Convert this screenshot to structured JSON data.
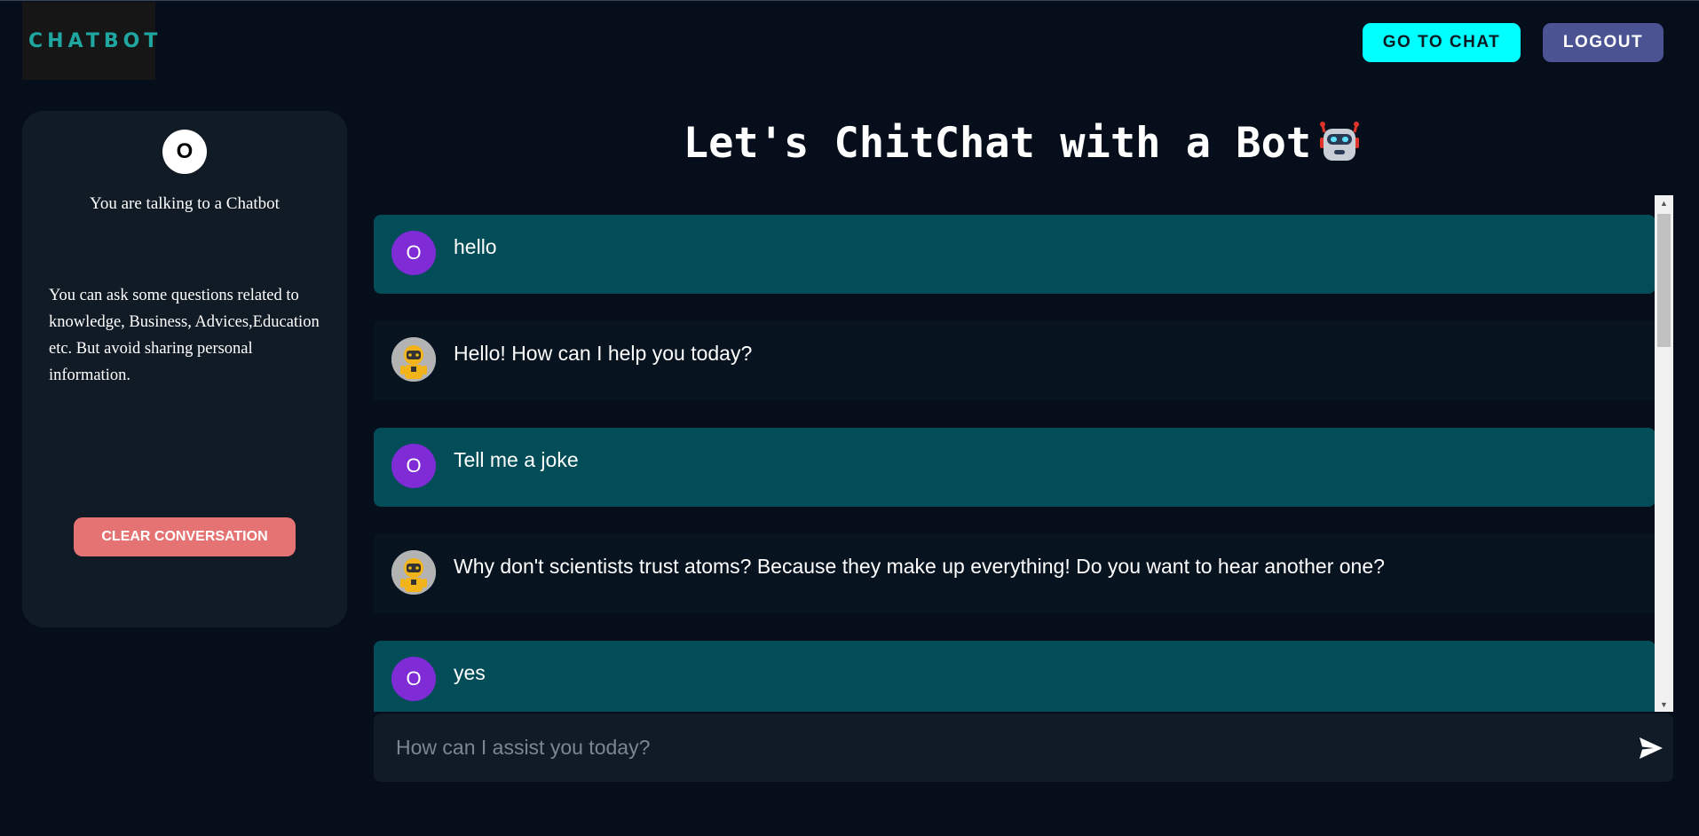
{
  "header": {
    "logo_text": "CHATBOT",
    "go_to_chat_label": "GO TO CHAT",
    "logout_label": "LOGOUT"
  },
  "sidebar": {
    "avatar_initial": "O",
    "title": "You are talking to a Chatbot",
    "description": "You can ask some questions related to knowledge, Business, Advices,Education etc. But avoid sharing personal information.",
    "clear_label": "CLEAR CONVERSATION"
  },
  "main": {
    "title": "Let's ChitChat with a Bot",
    "messages": [
      {
        "role": "user",
        "avatar": "O",
        "text": "hello"
      },
      {
        "role": "bot",
        "avatar": "robot-avatar-icon",
        "text": "Hello! How can I help you today?"
      },
      {
        "role": "user",
        "avatar": "O",
        "text": "Tell me a joke"
      },
      {
        "role": "bot",
        "avatar": "robot-avatar-icon",
        "text": "Why don't scientists trust atoms? Because they make up everything! Do you want to hear another one?"
      },
      {
        "role": "user",
        "avatar": "O",
        "text": "yes"
      }
    ],
    "input_placeholder": "How can I assist you today?",
    "input_value": ""
  },
  "colors": {
    "background": "#050e1a",
    "panel": "#111b26",
    "user_message": "#024d57",
    "bot_message": "#081320",
    "accent_cyan": "#00ffff",
    "logout": "#4c5392",
    "clear": "#e57373",
    "user_avatar": "#7f2bd6"
  },
  "icons": [
    "globe-logo-icon",
    "robot-emoji-icon",
    "robot-avatar-icon",
    "send-icon",
    "scroll-up-arrow-icon",
    "scroll-down-arrow-icon"
  ]
}
